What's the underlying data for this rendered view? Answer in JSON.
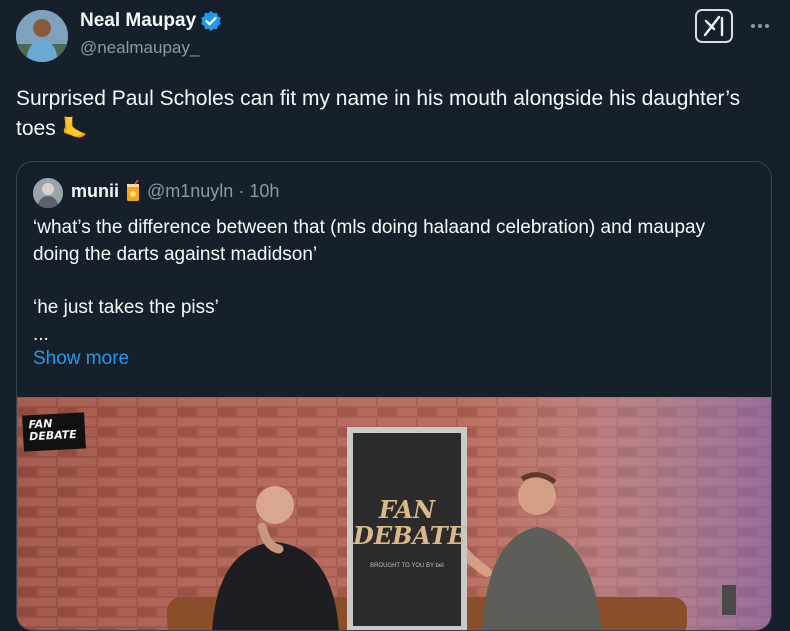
{
  "author": {
    "name": "Neal Maupay",
    "handle": "@nealmaupay_",
    "verified": true,
    "verified_color": "#1d9bf0"
  },
  "tweet": {
    "text": "Surprised Paul Scholes can fit my name in his mouth alongside his daughter’s toes 🦶"
  },
  "toolbar": {
    "grok_icon": "grok-icon",
    "more_icon": "more-icon"
  },
  "quoted": {
    "name": "munii",
    "handle": "@m1nuyln",
    "separator": "·",
    "time": "10h",
    "lines": [
      "‘what’s the difference between that (mls doing halaand celebration) and maupay doing the darts against madidson’",
      "‘he just takes the piss’",
      "..."
    ],
    "show_more": "Show more",
    "media": {
      "logo_text": "FAN DEBATE",
      "banner_title": "FAN DEBATE",
      "banner_sub": "BROUGHT TO YOU BY bet"
    }
  },
  "colors": {
    "background": "#15202b",
    "text": "#f7f9f9",
    "secondary": "#8b98a5",
    "link": "#1d9bf0",
    "border": "#38444d"
  }
}
